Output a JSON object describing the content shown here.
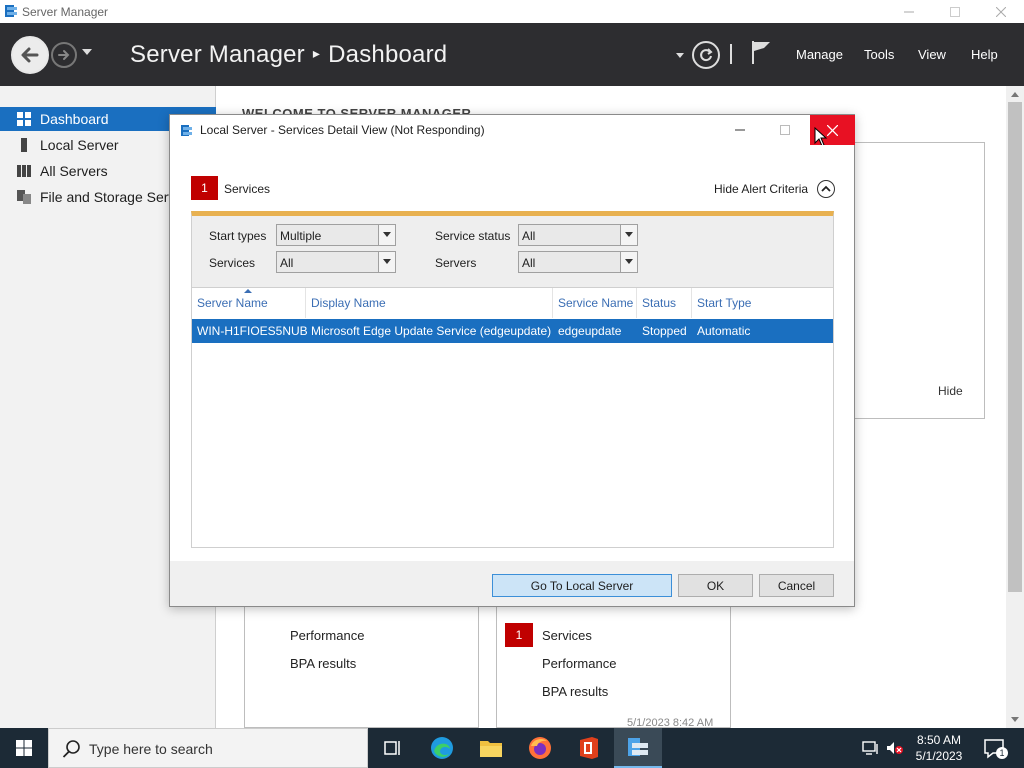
{
  "window": {
    "title": "Server Manager"
  },
  "header": {
    "app_name": "Server Manager",
    "separator": "▸",
    "page": "Dashboard",
    "menu": [
      "Manage",
      "Tools",
      "View",
      "Help"
    ]
  },
  "sidebar": {
    "items": [
      {
        "label": "Dashboard",
        "icon": "dashboard-icon",
        "active": true
      },
      {
        "label": "Local Server",
        "icon": "server-icon",
        "active": false
      },
      {
        "label": "All Servers",
        "icon": "servers-icon",
        "active": false
      },
      {
        "label": "File and Storage Serv",
        "icon": "storage-icon",
        "active": false
      }
    ]
  },
  "main": {
    "welcome": "WELCOME TO SERVER MANAGER",
    "hide_label": "Hide",
    "tile_left": {
      "items": [
        "Performance",
        "BPA results"
      ]
    },
    "tile_right": {
      "badge": "1",
      "items": [
        "Services",
        "Performance",
        "BPA results"
      ],
      "timestamp": "5/1/2023 8:42 AM"
    }
  },
  "dialog": {
    "title": "Local Server - Services Detail View (Not Responding)",
    "alert_count": "1",
    "alert_label": "Services",
    "hide_alert_criteria": "Hide Alert Criteria",
    "criteria": {
      "start_types_label": "Start types",
      "start_types_value": "Multiple",
      "services_label": "Services",
      "services_value": "All",
      "service_status_label": "Service status",
      "service_status_value": "All",
      "servers_label": "Servers",
      "servers_value": "All"
    },
    "columns": [
      "Server Name",
      "Display Name",
      "Service Name",
      "Status",
      "Start Type"
    ],
    "rows": [
      [
        "WIN-H1FIOES5NUB",
        "Microsoft Edge Update Service (edgeupdate)",
        "edgeupdate",
        "Stopped",
        "Automatic"
      ]
    ],
    "buttons": {
      "goto": "Go To Local Server",
      "ok": "OK",
      "cancel": "Cancel"
    }
  },
  "taskbar": {
    "search_placeholder": "Type here to search",
    "time": "8:50 AM",
    "date": "5/1/2023",
    "notification_count": "1"
  },
  "colors": {
    "header_bg": "#2d2d30",
    "selection": "#1a6fc0",
    "alert_red": "#c00000",
    "criteria_bar": "#e8b150",
    "close_red": "#e81123",
    "taskbar_bg": "#1c2a36"
  }
}
